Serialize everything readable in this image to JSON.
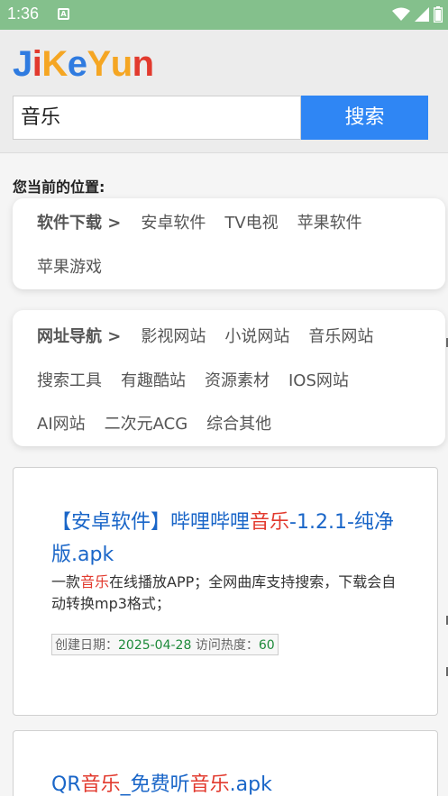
{
  "status_bar": {
    "time": "1:36",
    "notification_icon": "text-a-icon"
  },
  "logo": {
    "letters": [
      {
        "ch": "J",
        "color": "#2f7be0"
      },
      {
        "ch": "i",
        "color": "#e23a2e"
      },
      {
        "ch": "K",
        "color": "#f5a623"
      },
      {
        "ch": "e",
        "color": "#2f7be0"
      },
      {
        "ch": "Y",
        "color": "#f5a623"
      },
      {
        "ch": "u",
        "color": "#f5a623"
      },
      {
        "ch": "n",
        "color": "#e23a2e"
      }
    ]
  },
  "search": {
    "value": "音乐",
    "button_label": "搜索"
  },
  "location_label": "您当前的位置:",
  "software_card": {
    "category": "软件下载 >",
    "row1": [
      "安卓软件",
      "TV电视",
      "苹果软件"
    ],
    "row2": [
      "苹果游戏"
    ]
  },
  "nav_card": {
    "category": "网址导航 >",
    "row1": [
      "影视网站",
      "小说网站",
      "音乐网站"
    ],
    "row2": [
      "搜索工具",
      "有趣酷站",
      "资源素材",
      "IOS网站"
    ],
    "row3": [
      "AI网站",
      "二次元ACG",
      "综合其他"
    ]
  },
  "results": [
    {
      "title_parts": [
        {
          "text": "【安卓软件】哔哩哔哩",
          "red": false
        },
        {
          "text": "音乐",
          "red": true
        },
        {
          "text": "-1.2.1-纯净版.apk",
          "red": false
        }
      ],
      "desc_parts": [
        {
          "text": "一款",
          "red": false
        },
        {
          "text": "音乐",
          "red": true
        },
        {
          "text": "在线播放APP；全网曲库支持搜索，下载会自动转换mp3格式；",
          "red": false
        }
      ],
      "meta_date_label": "创建日期：",
      "meta_date": "2025-04-28",
      "meta_hot_label": " 访问热度：",
      "meta_hot": "60"
    },
    {
      "title_parts": [
        {
          "text": "QR",
          "red": false
        },
        {
          "text": "音乐",
          "red": true
        },
        {
          "text": "_免费听",
          "red": false
        },
        {
          "text": "音乐",
          "red": true
        },
        {
          "text": ".apk",
          "red": false
        }
      ]
    }
  ]
}
